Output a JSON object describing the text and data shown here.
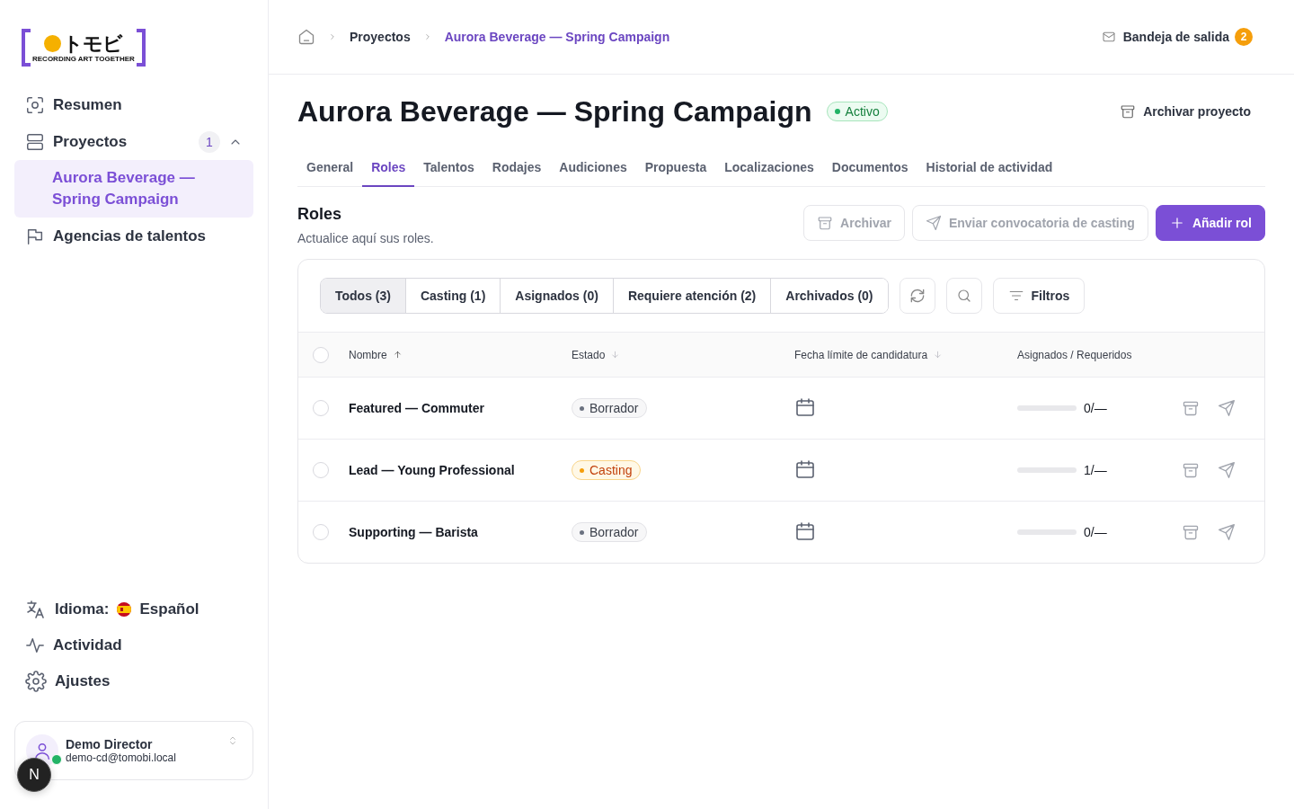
{
  "sidebar": {
    "logo": {
      "text": "トモビ",
      "tagline": "RECORDING ART TOGETHER"
    },
    "nav": [
      {
        "label": "Resumen",
        "kind": "scan",
        "selected": false
      },
      {
        "label": "Proyectos",
        "kind": "stack",
        "badge": "1",
        "expanded": true,
        "selected": false,
        "children": [
          {
            "label": "Aurora Beverage — Spring Campaign",
            "selected": true
          }
        ]
      },
      {
        "label": "Agencias de talentos",
        "kind": "flag",
        "selected": false
      }
    ],
    "bottom_nav": [
      {
        "label": "Idioma:",
        "value": "Español",
        "kind": "translate"
      },
      {
        "label": "Actividad",
        "kind": "activity"
      },
      {
        "label": "Ajustes",
        "kind": "settings"
      }
    ],
    "user": {
      "name": "Demo Director",
      "email": "demo-cd@tomobi.local",
      "online": true
    },
    "dev_badge": "N"
  },
  "breadcrumbs": [
    {
      "label": "Proyectos",
      "current": false
    },
    {
      "label": "Aurora Beverage — Spring Campaign",
      "current": true
    }
  ],
  "outbox": {
    "label": "Bandeja de salida",
    "count": "2"
  },
  "project": {
    "title": "Aurora Beverage — Spring Campaign",
    "status": "Activo",
    "archive_button": "Archivar proyecto"
  },
  "tabs": [
    {
      "label": "General",
      "selected": false
    },
    {
      "label": "Roles",
      "selected": true
    },
    {
      "label": "Talentos",
      "selected": false
    },
    {
      "label": "Rodajes",
      "selected": false
    },
    {
      "label": "Audiciones",
      "selected": false
    },
    {
      "label": "Propuesta",
      "selected": false
    },
    {
      "label": "Localizaciones",
      "selected": false
    },
    {
      "label": "Documentos",
      "selected": false
    },
    {
      "label": "Historial de actividad",
      "selected": false
    }
  ],
  "section": {
    "title": "Roles",
    "subtitle": "Actualice aquí sus roles.",
    "buttons": [
      {
        "label": "Archivar",
        "kind": "archive",
        "disabled": true
      },
      {
        "label": "Enviar convocatoria de casting",
        "kind": "send",
        "disabled": true
      },
      {
        "label": "Añadir rol",
        "kind": "add",
        "disabled": false
      }
    ]
  },
  "filters": [
    {
      "label": "Todos (3)",
      "selected": true
    },
    {
      "label": "Casting (1)",
      "selected": false
    },
    {
      "label": "Asignados (0)",
      "selected": false
    },
    {
      "label": "Requiere atención (2)",
      "selected": false
    },
    {
      "label": "Archivados (0)",
      "selected": false
    }
  ],
  "filter_button": "Filtros",
  "table": {
    "select_all_checked": false,
    "columns": [
      {
        "label": "Nombre",
        "sorted": true
      },
      {
        "label": "Estado",
        "sorted": false
      },
      {
        "label": "Fecha límite de candidatura",
        "sorted": false
      },
      {
        "label": "Asignados / Requeridos"
      }
    ],
    "rows": [
      {
        "name": "Featured — Commuter",
        "checked": false,
        "status": {
          "label": "Borrador",
          "kind": "draft"
        },
        "assigned": "0/—"
      },
      {
        "name": "Lead — Young Professional",
        "checked": false,
        "status": {
          "label": "Casting",
          "kind": "casting"
        },
        "assigned": "1/—"
      },
      {
        "name": "Supporting — Barista",
        "checked": false,
        "status": {
          "label": "Borrador",
          "kind": "draft"
        },
        "assigned": "0/—"
      }
    ]
  }
}
